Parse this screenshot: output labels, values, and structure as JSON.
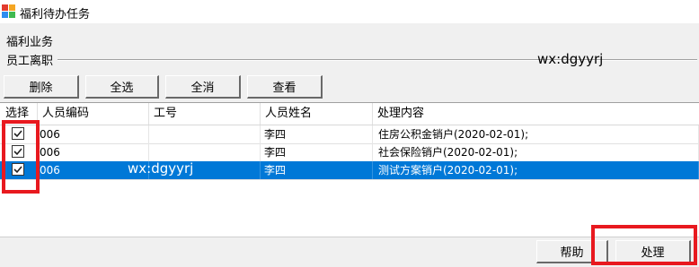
{
  "window": {
    "title": "福利待办任务"
  },
  "labels": {
    "section": "福利业务",
    "group": "员工离职",
    "watermark": "wx:dgyyrj"
  },
  "toolbar": {
    "delete": "删除",
    "select_all": "全选",
    "clear_all": "全消",
    "view": "查看"
  },
  "table": {
    "headers": {
      "select": "选择",
      "emp_code": "人员编码",
      "job_no": "工号",
      "emp_name": "人员姓名",
      "content": "处理内容"
    },
    "rows": [
      {
        "checked": true,
        "emp_code": "006",
        "job_no": "",
        "emp_name": "李四",
        "content": "住房公积金销户(2020-02-01);",
        "selected": false
      },
      {
        "checked": true,
        "emp_code": "006",
        "job_no": "",
        "emp_name": "李四",
        "content": "社会保险销户(2020-02-01);",
        "selected": false
      },
      {
        "checked": true,
        "emp_code": "006",
        "job_no": "",
        "emp_name": "李四",
        "content": "测试方案销户(2020-02-01);",
        "selected": true
      }
    ]
  },
  "footer": {
    "help": "帮助",
    "process": "处理"
  },
  "colors": {
    "selection": "#0078d7",
    "highlight": "#e8191f"
  }
}
